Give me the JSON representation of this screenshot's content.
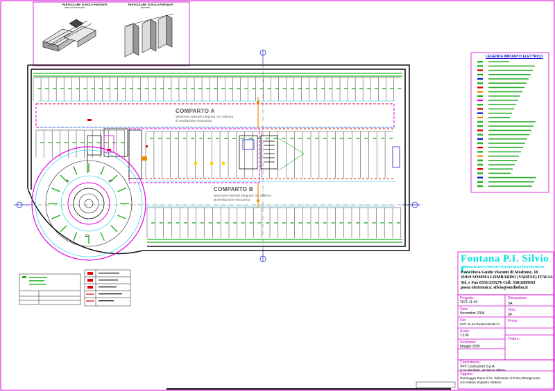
{
  "details": {
    "left_title": "PARTICOLARE: SCIVOLO PORTANTE",
    "left_subtitle": "PER AUTOVETTURE",
    "right_title": "PARTICOLARE: SCIVOLO PORTANTE",
    "right_subtitle": "SEZIONE"
  },
  "compartments": [
    {
      "name": "COMPARTO A",
      "desc_line1": "aerazione naturale integrata con sistema",
      "desc_line2": "di ventilazione meccanica"
    },
    {
      "name": "COMPARTO B",
      "desc_line1": "aerazione naturale integrata con sistema",
      "desc_line2": "di ventilazione meccanica"
    }
  ],
  "legend": {
    "title": "LEGENDA IMPIANTO ELETTRICO"
  },
  "firm": {
    "name": "Fontana P.I. Silvio C.",
    "tagline": "CONSULENZE E PROGETTAZIONI ELETTROTECNICHE",
    "address1": "P.zza Duca Guido Visconti di Modrone, 18",
    "address2": "21019 SOMMA LOMBARDO (VARESE) ITALIA",
    "phone": "Tel. e Fax 0331/259276 Cell. 338/2669163",
    "email": "posta elettronica: silvio@studiofon.it"
  },
  "title_block": {
    "progetto_label": "Progetto:",
    "progetto_value": "2071-11-04",
    "data_label": "Data:",
    "data_value": "Novembre 2004",
    "file_label": "File:",
    "file_value": "2071-11-04-Tavola3-05-08.rv1",
    "scala_label": "Scala:",
    "scala_value": "1:100",
    "revisione_label": "Revisione:",
    "revisione_value": "Maggio 2005",
    "disegnatore_label": "Disegnatore:",
    "disegnatore_value": "SA",
    "visto_label": "Visto:",
    "visto_value": "SF",
    "firma_label": "Firma:",
    "timbro_label": "Timbro:",
    "committente_label": "Committente:",
    "committente_line1": "VFV Costruzioni S.p.A.",
    "committente_line2": "C.so Monforte, 45-20122 Milano",
    "oggetto_label": "Oggetto:",
    "oggetto_line1": "Parcheggio Piano 2°int. dell'isolato di P.zza Risorgimento",
    "oggetto_line2": "con relativo impianto elettrico"
  },
  "colors": {
    "border": "#d000d0",
    "wall": "#111111",
    "green": "#1db31d",
    "cyan": "#00c8e0",
    "red": "#e00000",
    "magenta": "#e000e0",
    "orange": "#f08a00",
    "blue": "#1818d0",
    "yellow": "#ffd400"
  }
}
